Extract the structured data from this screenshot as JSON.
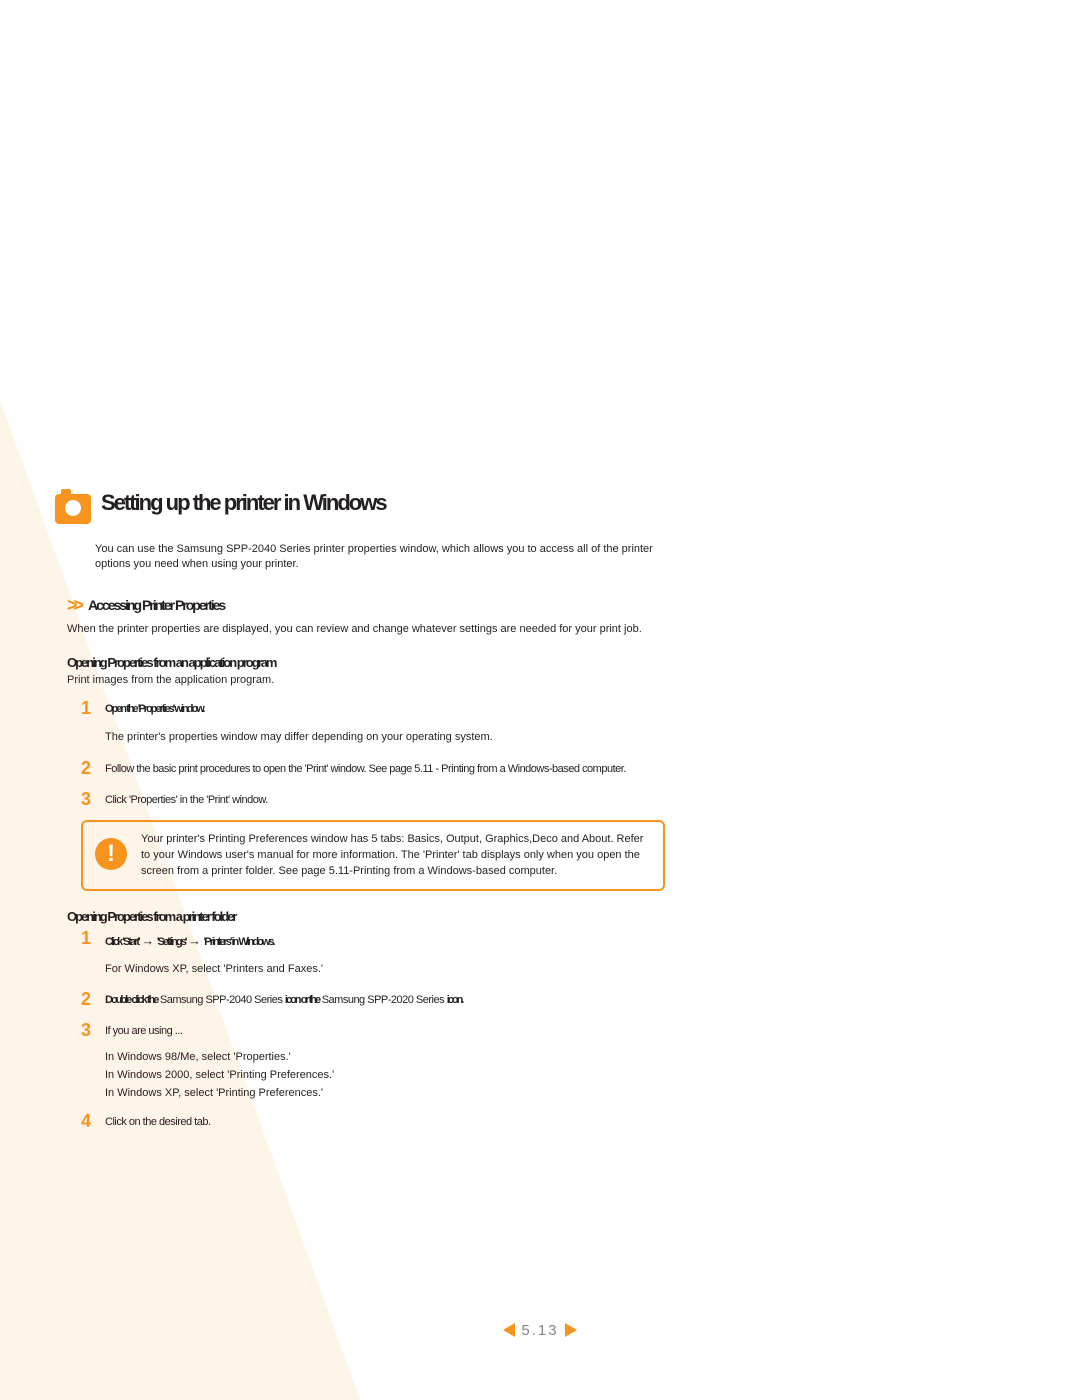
{
  "title": "Setting up the printer in Windows",
  "intro": "You can use the Samsung SPP-2040 Series printer properties window, which allows you to access all of the printer options you need when using your printer.",
  "section1": {
    "heading": "Accessing Printer Properties",
    "body": "When the printer properties are displayed, you can review and change whatever settings are needed for your print job."
  },
  "sub1": {
    "heading": "Opening Properties from an application program",
    "body": "Print images from the application program.",
    "steps": {
      "s1_bold": "Open the 'Properties' window.",
      "s1_note": "The printer's properties window may differ depending on your operating system.",
      "s2": "Follow the basic print procedures to open the 'Print' window. See page 5.11 - Printing from a Windows-based computer.",
      "s3": "Click 'Properties' in the 'Print' window."
    }
  },
  "infobox": "Your printer's Printing Preferences window has 5 tabs: Basics, Output, Graphics,Deco and About. Refer to your Windows user's manual for more information.\nThe 'Printer' tab displays only when you open the screen from a printer folder. See page 5.11-Printing from a Windows-based computer.",
  "sub2": {
    "heading": "Opening Properties from a printer folder",
    "steps": {
      "s1_p1": "Click 'Start'",
      "s1_p2": "'Settings'",
      "s1_p3": "'Printers' in Windows.",
      "s1_note": "For Windows XP, select 'Printers and Faxes.'",
      "s2_p1": "Double click the",
      "s2_bold1": "Samsung SPP-2040 Series",
      "s2_p2": "icon or the",
      "s2_bold2": "Samsung SPP-2020 Series",
      "s2_p3": "icon.",
      "s3": "If you are using ...",
      "s3_os1": "In Windows 98/Me, select 'Properties.'",
      "s3_os2": "In Windows 2000, select 'Printing Preferences.'",
      "s3_os3": "In Windows XP, select 'Printing Preferences.'",
      "s4": "Click on the desired tab."
    }
  },
  "page_number": "5.13"
}
